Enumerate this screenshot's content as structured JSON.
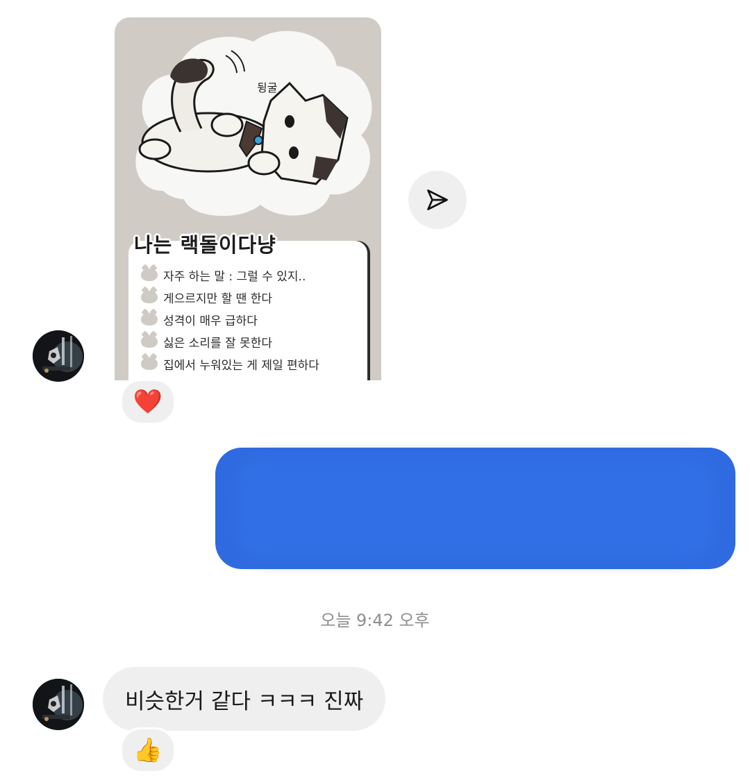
{
  "shared_post": {
    "title": "나는 랙돌이다냥",
    "sound_effect": "뒹굴",
    "traits": [
      "자주 하는 말 : 그럴 수 있지..",
      "게으르지만 할 땐 한다",
      "성격이 매우 급하다",
      "싫은 소리를 잘 못한다",
      "집에서 누워있는 게 제일 편하다"
    ]
  },
  "reactions": {
    "first": "❤️",
    "second": "👍"
  },
  "timestamp": "오늘 9:42 오후",
  "incoming_message": "비슷한거 같다 ㅋㅋㅋ 진짜",
  "icons": {
    "share": "send-icon",
    "avatar": "profile-photo"
  },
  "colors": {
    "outgoing_bubble": "#2f6ae0",
    "incoming_bubble": "#efefef",
    "card_background": "#d0ccc5",
    "timestamp": "#8e8e8e"
  }
}
